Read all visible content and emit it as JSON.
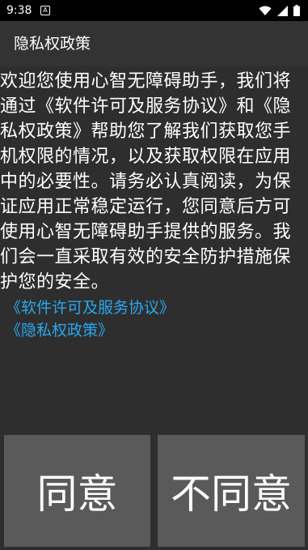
{
  "status_bar": {
    "time": "9:38",
    "notification_icon": "A",
    "icons": [
      "wifi-icon",
      "signal-icon",
      "battery-icon"
    ]
  },
  "action_bar": {
    "title": "隐私权政策"
  },
  "content": {
    "body": "欢迎您使用心智无障碍助手，我们将通过《软件许可及服务协议》和《隐私权政策》帮助您了解我们获取您手机权限的情况，以及获取权限在应用中的必要性。请务必认真阅读，为保证应用正常稳定运行，您同意后方可使用心智无障碍助手提供的服务。我们会一直采取有效的安全防护措施保护您的安全。",
    "link_license": "《软件许可及服务协议》",
    "link_privacy": "《隐私权政策》"
  },
  "buttons": {
    "agree": "同意",
    "disagree": "不同意"
  },
  "colors": {
    "background": "#2e2e2e",
    "action_bar": "#333333",
    "button": "#5a5a5a",
    "link": "#2aa7ef",
    "text": "#ffffff"
  }
}
